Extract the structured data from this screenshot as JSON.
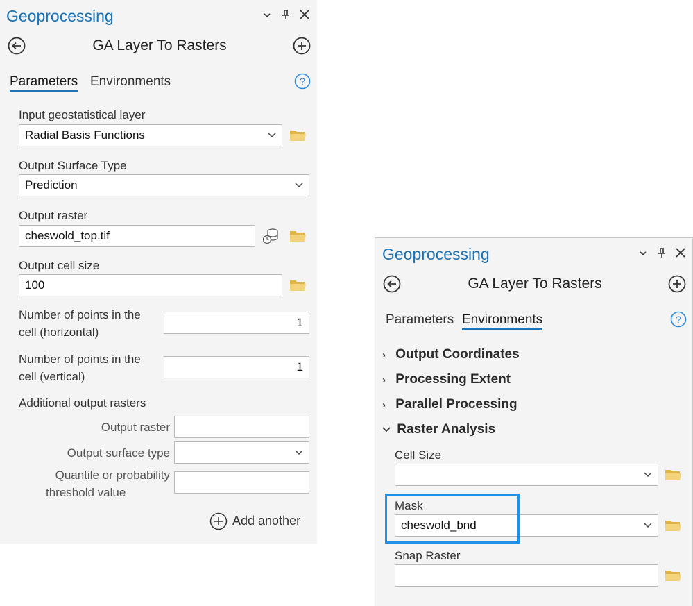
{
  "left_panel": {
    "pane_title": "Geoprocessing",
    "tool_title": "GA Layer To Rasters",
    "tabs": [
      {
        "label": "Parameters",
        "active": true
      },
      {
        "label": "Environments",
        "active": false
      }
    ],
    "params": {
      "input_layer": {
        "label": "Input geostatistical layer",
        "value": "Radial Basis Functions"
      },
      "surface_type": {
        "label": "Output Surface Type",
        "value": "Prediction"
      },
      "output_raster": {
        "label": "Output raster",
        "value": "cheswold_top.tif"
      },
      "cell_size": {
        "label": "Output cell size",
        "value": "100"
      },
      "points_h": {
        "label_line1": "Number of points in the",
        "label_line2": "cell (horizontal)",
        "value": "1"
      },
      "points_v": {
        "label_line1": "Number of points in the",
        "label_line2": "cell (vertical)",
        "value": "1"
      },
      "additional": {
        "label": "Additional output rasters",
        "output_raster_label": "Output raster",
        "output_surface_type_label": "Output surface type",
        "threshold_label_line1": "Quantile or probability",
        "threshold_label_line2": "threshold value",
        "add_another": "Add another"
      }
    }
  },
  "right_panel": {
    "pane_title": "Geoprocessing",
    "tool_title": "GA Layer To Rasters",
    "tabs": [
      {
        "label": "Parameters",
        "active": false
      },
      {
        "label": "Environments",
        "active": true
      }
    ],
    "sections": [
      {
        "label": "Output Coordinates",
        "expanded": false
      },
      {
        "label": "Processing Extent",
        "expanded": false
      },
      {
        "label": "Parallel Processing",
        "expanded": false
      },
      {
        "label": "Raster Analysis",
        "expanded": true
      }
    ],
    "raster_analysis": {
      "cell_size": {
        "label": "Cell Size",
        "value": ""
      },
      "mask": {
        "label": "Mask",
        "value": "cheswold_bnd"
      },
      "snap_raster": {
        "label": "Snap Raster",
        "value": ""
      }
    }
  },
  "colors": {
    "accent": "#1a73b8",
    "highlight": "#1e90e6",
    "folder": "#e8c560",
    "panel_bg": "#f4f4f4"
  },
  "icons": [
    "chevron-down-icon",
    "pin-icon",
    "close-icon",
    "back-icon",
    "add-icon",
    "help-icon",
    "folder-icon",
    "database-icon",
    "dropdown-chevron-icon",
    "expand-arrow-icon"
  ]
}
